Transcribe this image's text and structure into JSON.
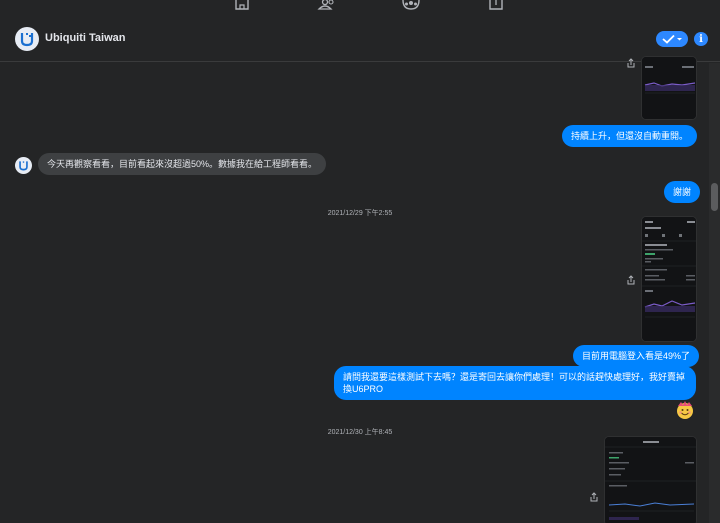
{
  "header": {
    "title": "Ubiquiti Taiwan"
  },
  "messages": {
    "m1": "持續上升，但還沒自動重開。",
    "m2": "今天再觀察看看，目前看起來沒超過50%。數據我在給工程師看看。",
    "m3": "謝謝",
    "ts1": "2021/12/29 下午2:55",
    "m4": "目前用電腦登入看是49%了",
    "m5": "請問我還要這樣測試下去嗎？還是寄回去讓你們處理！可以的話趕快處理好，我好賣掉換U6PRO",
    "ts2": "2021/12/30 上午8:45"
  },
  "colors": {
    "accent": "#0084ff",
    "incoming": "#3e4042",
    "background": "#242526"
  },
  "icons": [
    "home-icon",
    "people-icon",
    "group-icon",
    "bookmark-icon",
    "check-icon",
    "info-icon",
    "share-icon",
    "emoji-icon"
  ]
}
